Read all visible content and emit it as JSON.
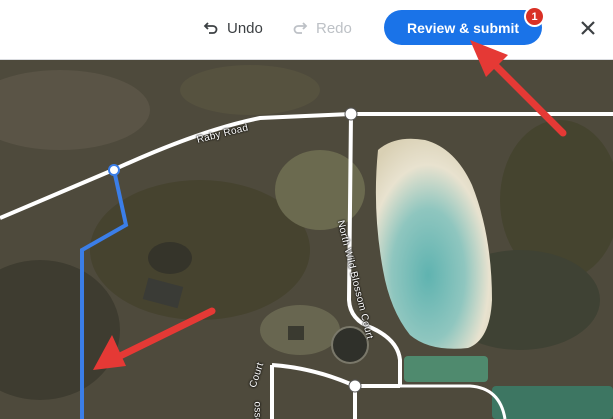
{
  "toolbar": {
    "undo_label": "Undo",
    "redo_label": "Redo",
    "submit_label": "Review & submit",
    "submit_badge": "1",
    "icons": {
      "undo": "undo-icon",
      "redo": "redo-icon",
      "close": "close-icon"
    }
  },
  "map": {
    "roads": {
      "raby": "Raby Road",
      "north_wild": "North Wild Blossom Court",
      "court": "Court",
      "bottom_left": "ossom"
    }
  },
  "colors": {
    "primary": "#1a73e8",
    "badge": "#d93025",
    "drawn_path": "#3b7ee8",
    "annotation_arrow": "#e53935"
  }
}
